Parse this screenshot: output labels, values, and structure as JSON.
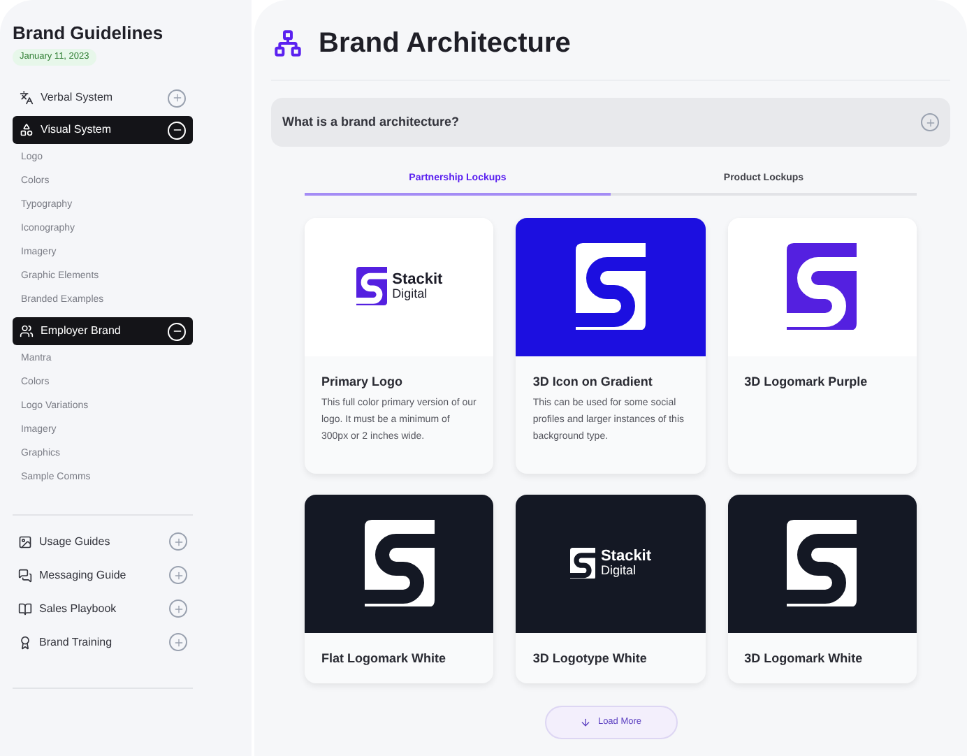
{
  "sidebar": {
    "title": "Brand Guidelines",
    "date": "January 11, 2023",
    "sections": [
      {
        "label": "Verbal System",
        "expanded": false
      },
      {
        "label": "Visual System",
        "expanded": true,
        "items": [
          "Logo",
          "Colors",
          "Typography",
          "Iconography",
          "Imagery",
          "Graphic Elements",
          "Branded Examples"
        ]
      },
      {
        "label": "Employer Brand",
        "expanded": true,
        "items": [
          "Mantra",
          "Colors",
          "Logo Variations",
          "Imagery",
          "Graphics",
          "Sample Comms"
        ]
      }
    ],
    "guides": [
      {
        "label": "Usage Guides",
        "expanded": false
      },
      {
        "label": "Messaging Guide",
        "expanded": false
      },
      {
        "label": "Sales Playbook",
        "expanded": false
      },
      {
        "label": "Brand Training",
        "expanded": false
      }
    ]
  },
  "page": {
    "title": "Brand Architecture",
    "accordion": {
      "label": "What is a brand architecture?",
      "expanded": false
    },
    "tabs": [
      {
        "label": "Partnership Lockups",
        "selected": true
      },
      {
        "label": "Product Lockups",
        "selected": false
      }
    ],
    "cards": [
      {
        "title": "Primary Logo",
        "description": "This full color primary version of our logo. It must be a minimum of 300px or 2 inches wide.",
        "preview": {
          "kind": "logotype",
          "color": "#ffffff",
          "wordmark": "Stackit",
          "subline": "Digital"
        }
      },
      {
        "title": "3D Icon on Gradient",
        "description": "This can be used for some social profiles and larger instances of this background type.",
        "preview": {
          "kind": "logomark",
          "color": "#1c0fe0"
        }
      },
      {
        "title": "3D Logomark Purple",
        "preview": {
          "kind": "logomark",
          "color": "#ffffff"
        }
      },
      {
        "title": "Flat Logomark White",
        "preview": {
          "kind": "logomark",
          "color": "#141824"
        }
      },
      {
        "title": "3D Logotype White",
        "preview": {
          "kind": "logotype",
          "color": "#141824",
          "wordmark": "Stackit",
          "subline": "Digital"
        }
      },
      {
        "title": "3D Logomark White",
        "preview": {
          "kind": "logomark",
          "color": "#141824"
        }
      }
    ],
    "load_more": "Load More"
  }
}
